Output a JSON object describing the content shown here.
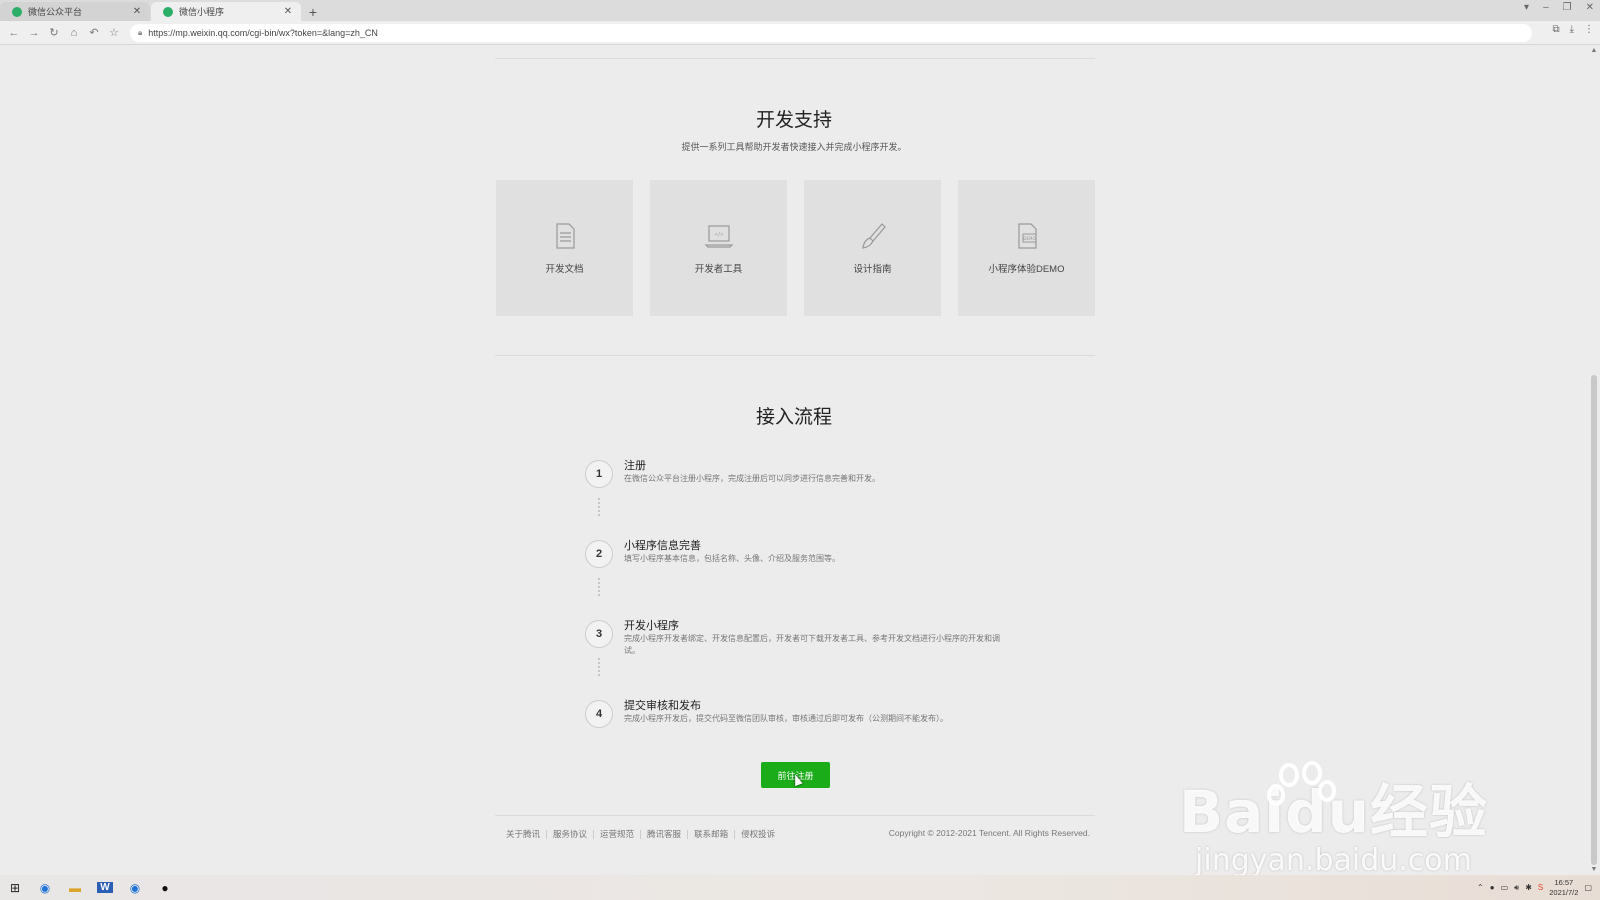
{
  "browser": {
    "tabs": [
      {
        "label": "微信公众平台",
        "active": false
      },
      {
        "label": "微信小程序",
        "active": true
      }
    ],
    "url": "https://mp.weixin.qq.com/cgi-bin/wx?token=&lang=zh_CN"
  },
  "dev_support": {
    "title": "开发支持",
    "subtitle": "提供一系列工具帮助开发者快速接入并完成小程序开发。",
    "cards": [
      {
        "label": "开发文档",
        "icon": "document-icon"
      },
      {
        "label": "开发者工具",
        "icon": "laptop-code-icon"
      },
      {
        "label": "设计指南",
        "icon": "brush-icon"
      },
      {
        "label": "小程序体验DEMO",
        "icon": "demo-doc-icon"
      }
    ]
  },
  "process": {
    "title": "接入流程",
    "steps": [
      {
        "num": "1",
        "title": "注册",
        "desc": "在微信公众平台注册小程序，完成注册后可以同步进行信息完善和开发。"
      },
      {
        "num": "2",
        "title": "小程序信息完善",
        "desc": "填写小程序基本信息，包括名称、头像、介绍及服务范围等。"
      },
      {
        "num": "3",
        "title": "开发小程序",
        "desc": "完成小程序开发者绑定、开发信息配置后，开发者可下载开发者工具、参考开发文档进行小程序的开发和调试。"
      },
      {
        "num": "4",
        "title": "提交审核和发布",
        "desc": "完成小程序开发后，提交代码至微信团队审核，审核通过后即可发布（公测期间不能发布）。"
      }
    ],
    "cta_label": "前往注册"
  },
  "footer": {
    "links": [
      "关于腾讯",
      "服务协议",
      "运营规范",
      "腾讯客服",
      "联系邮箱",
      "侵权投诉"
    ],
    "copyright": "Copyright © 2012-2021 Tencent. All Rights Reserved."
  },
  "watermark": {
    "line1": "Baidu经验",
    "line2": "jingyan.baidu.com"
  },
  "taskbar": {
    "time": "16:57",
    "date": "2021/7/2"
  },
  "colors": {
    "accent_green": "#1aad19",
    "tab_favicon": "#2bae67"
  }
}
